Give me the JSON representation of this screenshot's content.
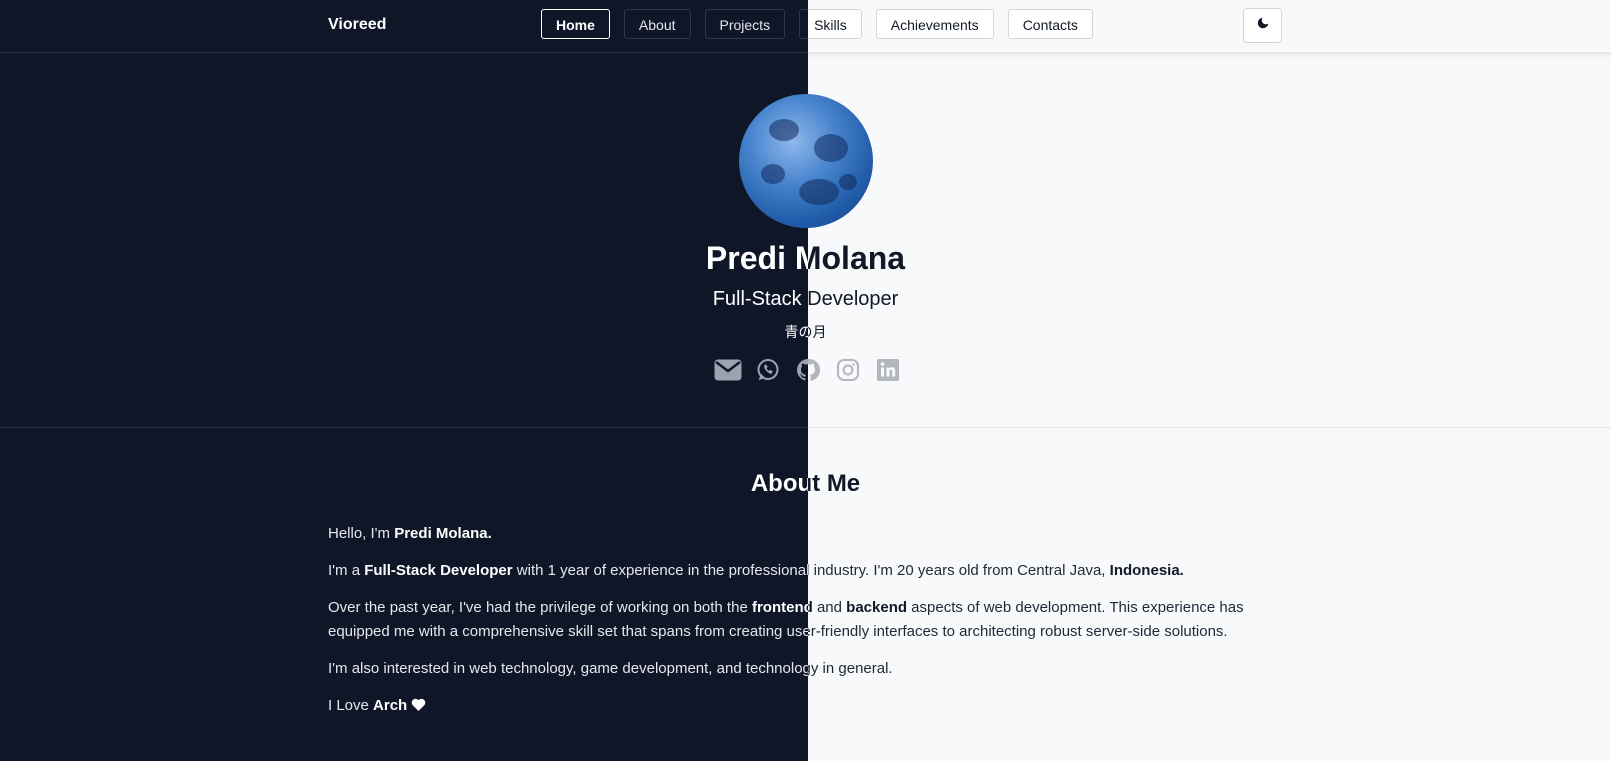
{
  "nav": {
    "brand": "Vioreed",
    "links": [
      {
        "label": "Home"
      },
      {
        "label": "About"
      },
      {
        "label": "Projects"
      },
      {
        "label": "Skills"
      },
      {
        "label": "Achievements"
      },
      {
        "label": "Contacts"
      }
    ],
    "active_link": "Home",
    "theme_toggle_icon": "moon-icon"
  },
  "hero": {
    "avatar_icon": "moon-avatar",
    "name": "Predi Molana",
    "role": "Full-Stack Developer",
    "japanese": "青の月",
    "socials": [
      "email-icon",
      "whatsapp-icon",
      "github-icon",
      "instagram-icon",
      "linkedin-icon"
    ]
  },
  "about": {
    "title": "About Me",
    "p1_pre": "Hello, I'm ",
    "p1_bold": "Predi Molana.",
    "p2_pre": "I'm a ",
    "p2_bold1": "Full-Stack Developer",
    "p2_mid": " with 1 year of experience in the professional industry. I'm 20 years old from Central Java, ",
    "p2_bold2": "Indonesia.",
    "p3_pre": "Over the past year, I've had the privilege of working on both the ",
    "p3_bold1": "frontend",
    "p3_mid": " and ",
    "p3_bold2": "backend",
    "p3_post": " aspects of web development. This experience has equipped me with a comprehensive skill set that spans from creating user-friendly interfaces to architecting robust server-side solutions.",
    "p4": "I'm also interested in web technology, game development, and technology in general.",
    "p5_pre": "I Love ",
    "p5_bold": "Arch",
    "p5_icon": "heart-icon"
  },
  "colors": {
    "dark_bg": "#0e1628",
    "light_bg": "#f8f9fb"
  }
}
